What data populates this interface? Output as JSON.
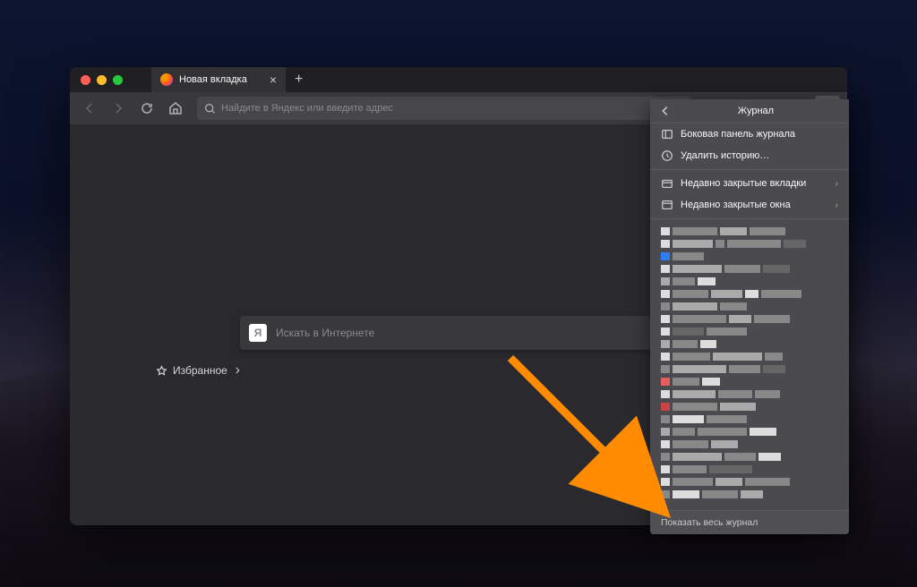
{
  "tab": {
    "title": "Новая вкладка"
  },
  "urlbar": {
    "placeholder": "Найдите в Яндекс или введите адрес"
  },
  "search": {
    "placeholder": "Искать в Интернете",
    "engine_icon_letter": "Я"
  },
  "favorites": {
    "label": "Избранное"
  },
  "panel": {
    "title": "Журнал",
    "sidebar": "Боковая панель журнала",
    "clear": "Удалить историю…",
    "recent_tabs": "Недавно закрытые вкладки",
    "recent_windows": "Недавно закрытые окна",
    "footer": "Показать весь журнал"
  },
  "colors": {
    "accent_arrow": "#ff8c00"
  }
}
